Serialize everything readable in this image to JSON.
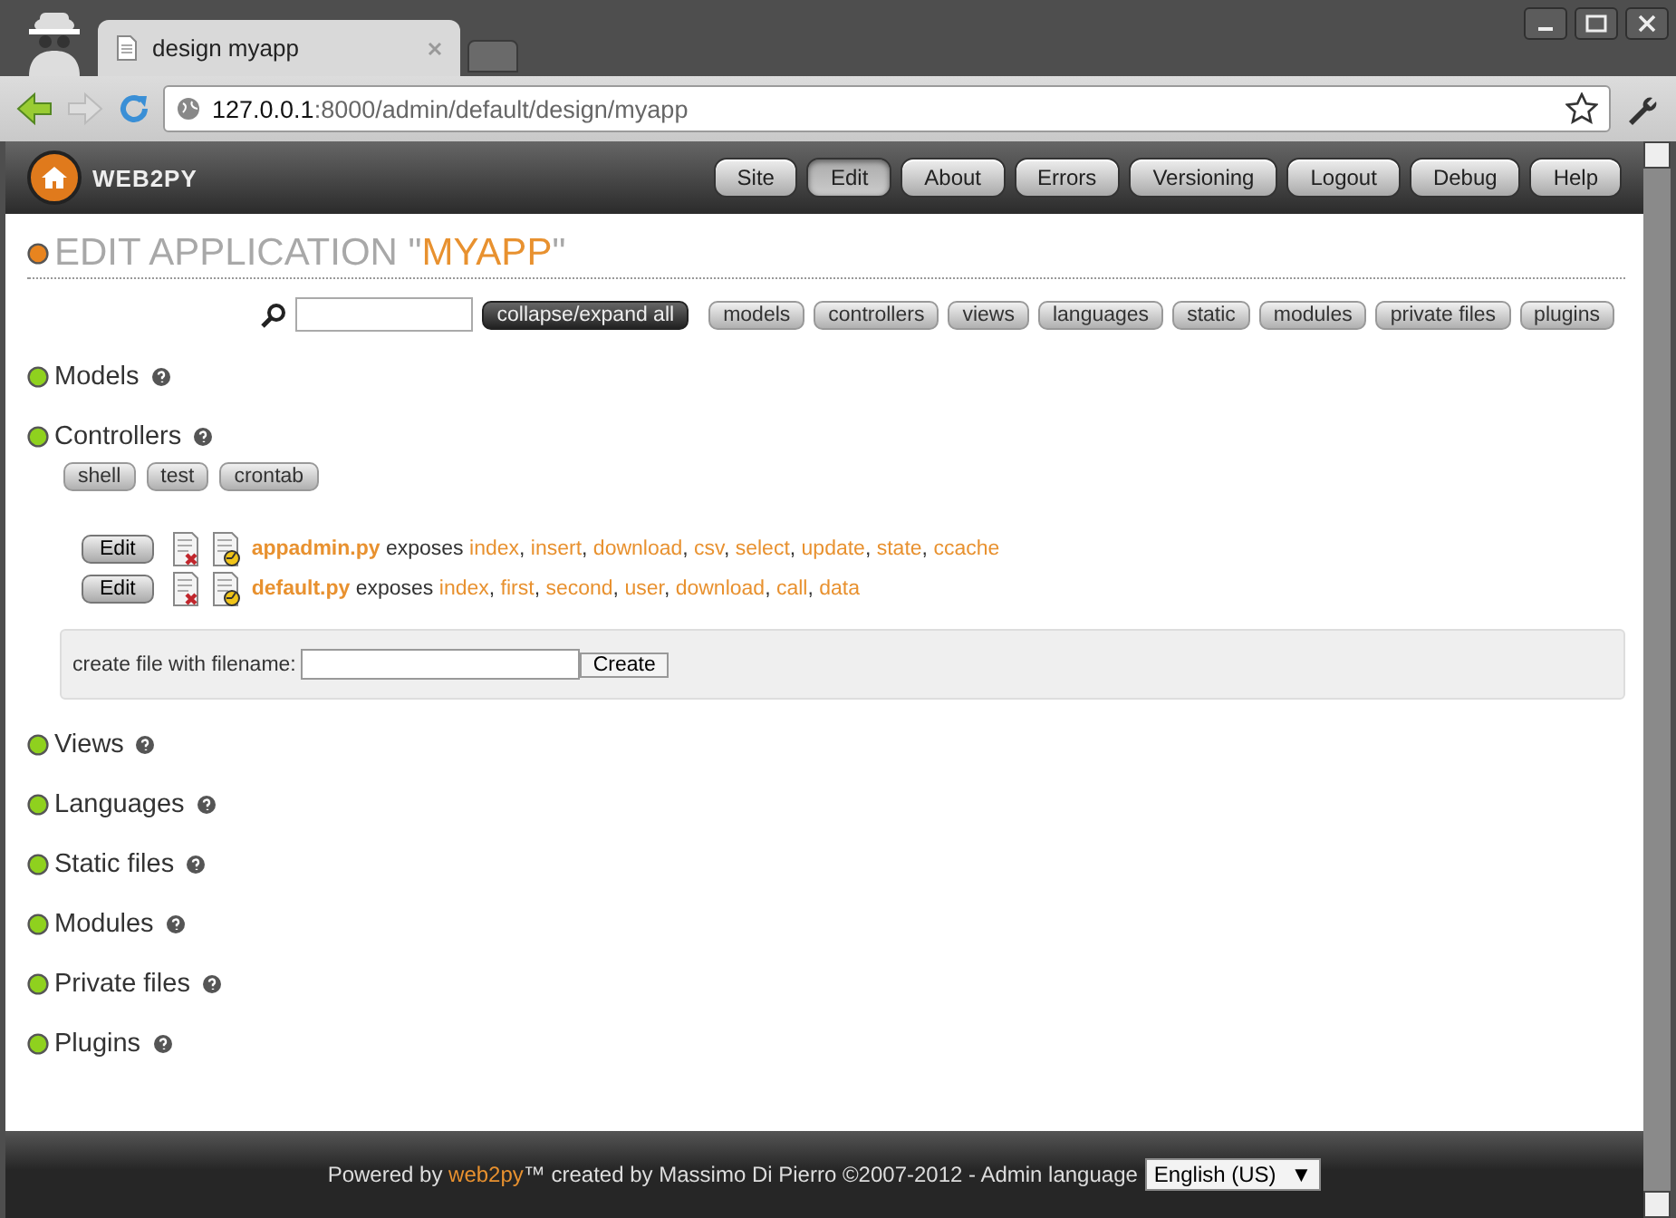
{
  "browser": {
    "tab_title": "design myapp",
    "url_host": "127.0.0.1",
    "url_path": ":8000/admin/default/design/myapp"
  },
  "header": {
    "logo": "WEB2PY",
    "nav": [
      {
        "label": "Site",
        "selected": false
      },
      {
        "label": "Edit",
        "selected": true
      },
      {
        "label": "About",
        "selected": false
      },
      {
        "label": "Errors",
        "selected": false
      },
      {
        "label": "Versioning",
        "selected": false
      },
      {
        "label": "Logout",
        "selected": false
      },
      {
        "label": "Debug",
        "selected": false
      },
      {
        "label": "Help",
        "selected": false
      }
    ]
  },
  "title": {
    "prefix": "EDIT APPLICATION \"",
    "app": "MYAPP",
    "suffix": "\""
  },
  "toolbar": {
    "toggle": "collapse/expand all",
    "jumps": [
      "models",
      "controllers",
      "views",
      "languages",
      "static",
      "modules",
      "private files",
      "plugins"
    ]
  },
  "sections": [
    {
      "label": "Models"
    },
    {
      "label": "Controllers",
      "tools": [
        "shell",
        "test",
        "crontab"
      ],
      "files": [
        {
          "edit": "Edit",
          "name": "appadmin.py",
          "verb": "exposes",
          "functions": [
            "index",
            "insert",
            "download",
            "csv",
            "select",
            "update",
            "state",
            "ccache"
          ]
        },
        {
          "edit": "Edit",
          "name": "default.py",
          "verb": "exposes",
          "functions": [
            "index",
            "first",
            "second",
            "user",
            "download",
            "call",
            "data"
          ]
        }
      ],
      "separator": ",",
      "create": {
        "label": "create file with filename:",
        "button": "Create"
      }
    },
    {
      "label": "Views"
    },
    {
      "label": "Languages"
    },
    {
      "label": "Static files"
    },
    {
      "label": "Modules"
    },
    {
      "label": "Private files"
    },
    {
      "label": "Plugins"
    }
  ],
  "footer": {
    "before": "Powered by ",
    "link": "web2py",
    "after": "™ created by Massimo Di Pierro ©2007-2012 - Admin language",
    "language": "English (US)",
    "arrow": "▼"
  }
}
